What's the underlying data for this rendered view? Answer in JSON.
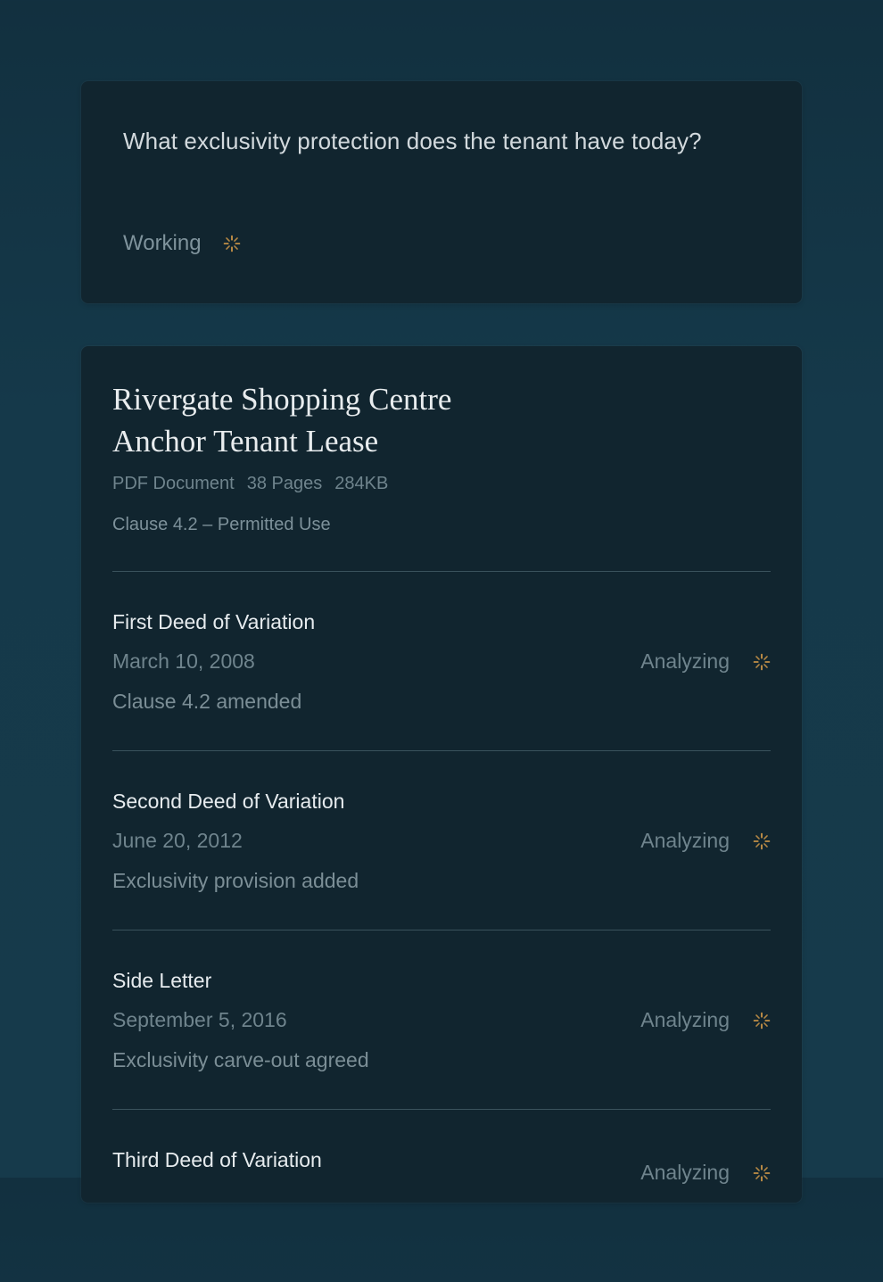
{
  "query": {
    "text": "What exclusivity protection does the tenant have today?",
    "status_label": "Working"
  },
  "document": {
    "title_line1": "Rivergate Shopping Centre",
    "title_line2": "Anchor Tenant Lease",
    "type": "PDF Document",
    "pages": "38 Pages",
    "size": "284KB",
    "clause": "Clause 4.2 – Permitted Use"
  },
  "entries": [
    {
      "title": "First Deed of Variation",
      "date": "March 10, 2008",
      "note": "Clause 4.2 amended",
      "status": "Analyzing"
    },
    {
      "title": "Second Deed of Variation",
      "date": "June 20, 2012",
      "note": "Exclusivity provision added",
      "status": "Analyzing"
    },
    {
      "title": "Side Letter",
      "date": "September 5, 2016",
      "note": "Exclusivity carve-out agreed",
      "status": "Analyzing"
    },
    {
      "title": "Third Deed of Variation",
      "date": "",
      "note": "",
      "status": "Analyzing"
    }
  ],
  "colors": {
    "spinner": "#e0a24a",
    "background": "#15394a",
    "card": "#11252f"
  },
  "icons": {
    "spinner": "spinner-icon"
  }
}
